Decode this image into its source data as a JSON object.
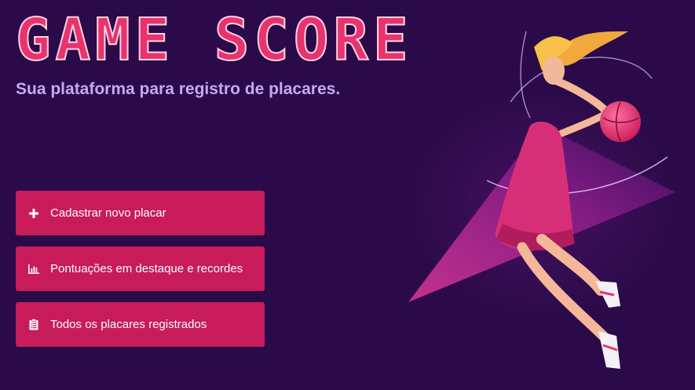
{
  "header": {
    "title": "GAME SCORE",
    "subtitle": "Sua plataforma para registro de placares."
  },
  "menu": {
    "items": [
      {
        "label": "Cadastrar novo placar",
        "icon": "plus-icon"
      },
      {
        "label": "Pontuações em destaque e recordes",
        "icon": "bar-chart-icon"
      },
      {
        "label": "Todos os placares registrados",
        "icon": "clipboard-list-icon"
      }
    ]
  },
  "hero": {
    "image": "basketball-player-illustration"
  },
  "colors": {
    "background": "#2a0a48",
    "accent": "#c81b5a",
    "title": "#e8336f",
    "subtitle": "#c9a8f2"
  }
}
